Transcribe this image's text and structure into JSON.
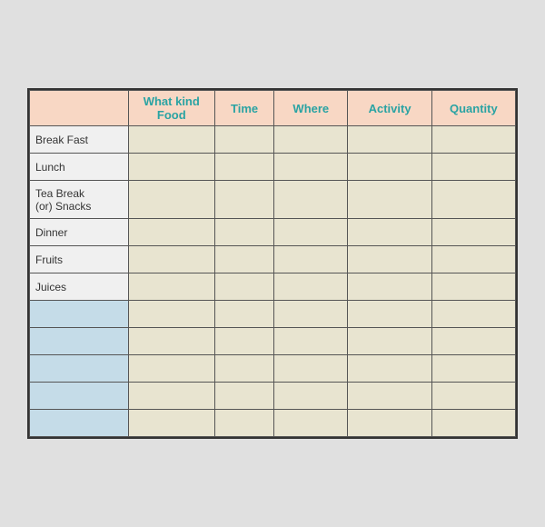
{
  "header": {
    "col1": "",
    "col2_line1": "What kind",
    "col2_line2": "Food",
    "col3": "Time",
    "col4": "Where",
    "col5": "Activity",
    "col6": "Quantity"
  },
  "rows": [
    {
      "label": "Break Fast",
      "type": "normal"
    },
    {
      "label": "Lunch",
      "type": "normal"
    },
    {
      "label": "Tea Break\n(or) Snacks",
      "type": "tall"
    },
    {
      "label": "Dinner",
      "type": "normal"
    },
    {
      "label": "Fruits",
      "type": "normal"
    },
    {
      "label": "Juices",
      "type": "normal"
    },
    {
      "label": "",
      "type": "blue"
    },
    {
      "label": "",
      "type": "blue"
    },
    {
      "label": "",
      "type": "blue"
    },
    {
      "label": "",
      "type": "blue"
    },
    {
      "label": "",
      "type": "blue"
    }
  ]
}
